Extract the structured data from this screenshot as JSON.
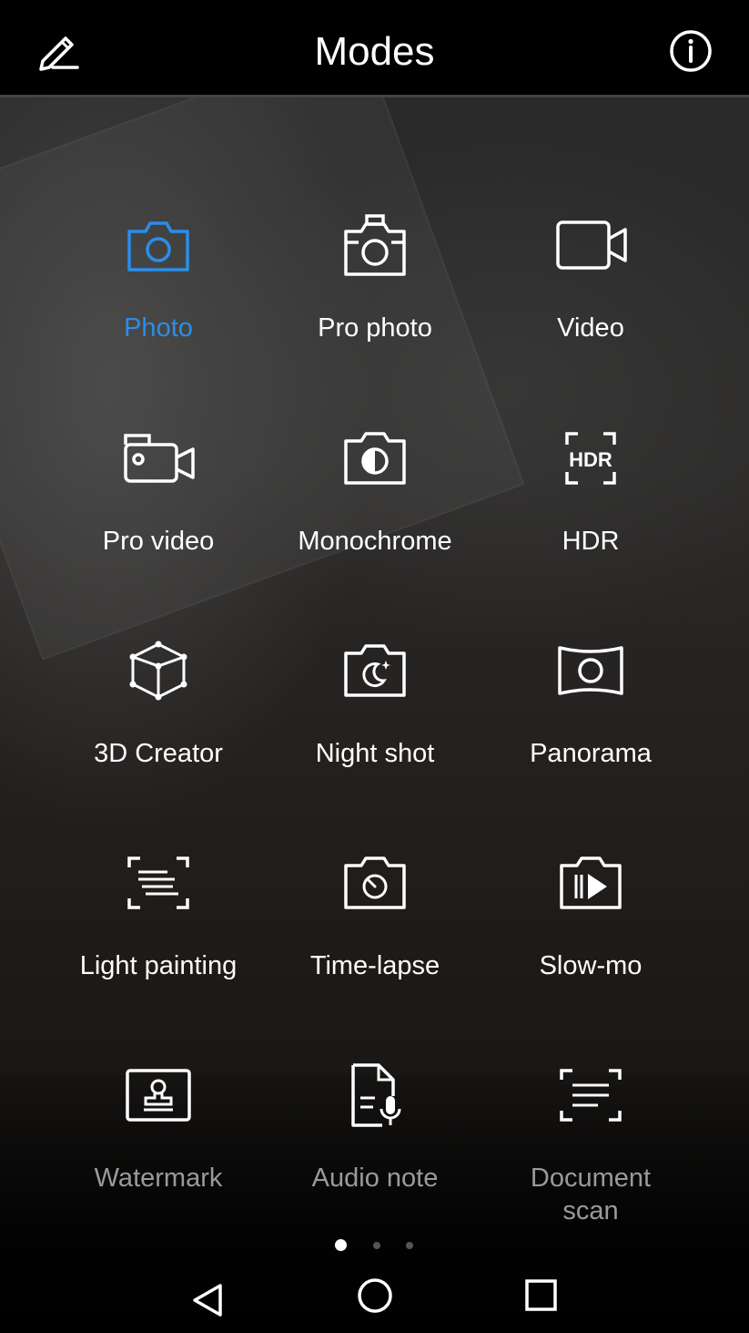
{
  "header": {
    "title": "Modes",
    "edit_icon": "pencil-edit-icon",
    "info_icon": "info-circle-icon"
  },
  "colors": {
    "accent": "#2a8ee8",
    "text": "#ffffff",
    "dim_text": "#9a9a9a",
    "topbar_bg": "#000000"
  },
  "modes": [
    {
      "label": "Photo",
      "icon": "camera-icon",
      "active": true
    },
    {
      "label": "Pro photo",
      "icon": "pro-camera-icon"
    },
    {
      "label": "Video",
      "icon": "video-camera-icon"
    },
    {
      "label": "Pro video",
      "icon": "pro-video-icon"
    },
    {
      "label": "Monochrome",
      "icon": "monochrome-icon"
    },
    {
      "label": "HDR",
      "icon": "hdr-icon"
    },
    {
      "label": "3D Creator",
      "icon": "cube-3d-icon"
    },
    {
      "label": "Night shot",
      "icon": "night-moon-camera-icon"
    },
    {
      "label": "Panorama",
      "icon": "panorama-icon"
    },
    {
      "label": "Light painting",
      "icon": "light-painting-icon"
    },
    {
      "label": "Time-lapse",
      "icon": "time-lapse-icon"
    },
    {
      "label": "Slow-mo",
      "icon": "slow-motion-icon"
    },
    {
      "label": "Watermark",
      "icon": "watermark-stamp-icon",
      "dim": true
    },
    {
      "label": "Audio note",
      "icon": "audio-note-icon",
      "dim": true
    },
    {
      "label": "Document\nscan",
      "icon": "document-scan-icon",
      "dim": true
    }
  ],
  "pager": {
    "pages": 3,
    "current": 1
  },
  "navbar": {
    "back_icon": "back-triangle-icon",
    "home_icon": "home-circle-icon",
    "recents_icon": "recents-square-icon"
  }
}
